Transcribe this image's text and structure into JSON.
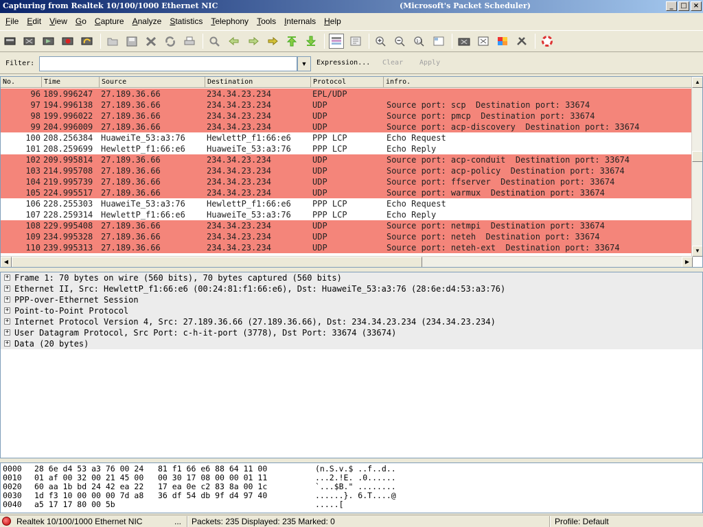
{
  "window": {
    "title_left": "Capturing from Realtek 10/100/1000 Ethernet NIC",
    "title_right": "(Microsoft's Packet Scheduler)"
  },
  "menu": [
    "File",
    "Edit",
    "View",
    "Go",
    "Capture",
    "Analyze",
    "Statistics",
    "Telephony",
    "Tools",
    "Internals",
    "Help"
  ],
  "filter": {
    "label": "Filter:",
    "value": "",
    "expression": "Expression...",
    "clear": "Clear",
    "apply": "Apply"
  },
  "packet_list": {
    "columns": [
      "No.",
      "Time",
      "Source",
      "Destination",
      "Protocol",
      "infro."
    ],
    "rows": [
      {
        "no": "96",
        "time": "189.996247",
        "src": "27.189.36.66",
        "dst": "234.34.23.234",
        "proto": "EPL/UDP",
        "info": "",
        "kind": "udp"
      },
      {
        "no": "97",
        "time": "194.996138",
        "src": "27.189.36.66",
        "dst": "234.34.23.234",
        "proto": "UDP",
        "info": "Source port: scp  Destination port: 33674",
        "kind": "udp"
      },
      {
        "no": "98",
        "time": "199.996022",
        "src": "27.189.36.66",
        "dst": "234.34.23.234",
        "proto": "UDP",
        "info": "Source port: pmcp  Destination port: 33674",
        "kind": "udp"
      },
      {
        "no": "99",
        "time": "204.996009",
        "src": "27.189.36.66",
        "dst": "234.34.23.234",
        "proto": "UDP",
        "info": "Source port: acp-discovery  Destination port: 33674",
        "kind": "udp"
      },
      {
        "no": "100",
        "time": "208.256384",
        "src": "HuaweiTe_53:a3:76",
        "dst": "HewlettP_f1:66:e6",
        "proto": "PPP LCP",
        "info": "Echo Request",
        "kind": "lcp"
      },
      {
        "no": "101",
        "time": "208.259699",
        "src": "HewlettP_f1:66:e6",
        "dst": "HuaweiTe_53:a3:76",
        "proto": "PPP LCP",
        "info": "Echo Reply",
        "kind": "lcp"
      },
      {
        "no": "102",
        "time": "209.995814",
        "src": "27.189.36.66",
        "dst": "234.34.23.234",
        "proto": "UDP",
        "info": "Source port: acp-conduit  Destination port: 33674",
        "kind": "udp"
      },
      {
        "no": "103",
        "time": "214.995708",
        "src": "27.189.36.66",
        "dst": "234.34.23.234",
        "proto": "UDP",
        "info": "Source port: acp-policy  Destination port: 33674",
        "kind": "udp"
      },
      {
        "no": "104",
        "time": "219.995739",
        "src": "27.189.36.66",
        "dst": "234.34.23.234",
        "proto": "UDP",
        "info": "Source port: ffserver  Destination port: 33674",
        "kind": "udp"
      },
      {
        "no": "105",
        "time": "224.995517",
        "src": "27.189.36.66",
        "dst": "234.34.23.234",
        "proto": "UDP",
        "info": "Source port: warmux  Destination port: 33674",
        "kind": "udp"
      },
      {
        "no": "106",
        "time": "228.255303",
        "src": "HuaweiTe_53:a3:76",
        "dst": "HewlettP_f1:66:e6",
        "proto": "PPP LCP",
        "info": "Echo Request",
        "kind": "lcp"
      },
      {
        "no": "107",
        "time": "228.259314",
        "src": "HewlettP_f1:66:e6",
        "dst": "HuaweiTe_53:a3:76",
        "proto": "PPP LCP",
        "info": "Echo Reply",
        "kind": "lcp"
      },
      {
        "no": "108",
        "time": "229.995408",
        "src": "27.189.36.66",
        "dst": "234.34.23.234",
        "proto": "UDP",
        "info": "Source port: netmpi  Destination port: 33674",
        "kind": "udp"
      },
      {
        "no": "109",
        "time": "234.995328",
        "src": "27.189.36.66",
        "dst": "234.34.23.234",
        "proto": "UDP",
        "info": "Source port: neteh  Destination port: 33674",
        "kind": "udp"
      },
      {
        "no": "110",
        "time": "239.995313",
        "src": "27.189.36.66",
        "dst": "234.34.23.234",
        "proto": "UDP",
        "info": "Source port: neteh-ext  Destination port: 33674",
        "kind": "udp"
      }
    ]
  },
  "details": [
    "Frame 1: 70 bytes on wire (560 bits), 70 bytes captured (560 bits)",
    "Ethernet II, Src: HewlettP_f1:66:e6 (00:24:81:f1:66:e6), Dst: HuaweiTe_53:a3:76 (28:6e:d4:53:a3:76)",
    "PPP-over-Ethernet Session",
    "Point-to-Point Protocol",
    "Internet Protocol Version 4, Src: 27.189.36.66 (27.189.36.66), Dst: 234.34.23.234 (234.34.23.234)",
    "User Datagram Protocol, Src Port: c-h-it-port (3778), Dst Port: 33674 (33674)",
    "Data (20 bytes)"
  ],
  "hex": [
    {
      "offset": "0000",
      "bytes": "28 6e d4 53 a3 76 00 24   81 f1 66 e6 88 64 11 00",
      "ascii": "(n.S.v.$ ..f..d.."
    },
    {
      "offset": "0010",
      "bytes": "01 af 00 32 00 21 45 00   00 30 17 08 00 00 01 11",
      "ascii": "...2.!E. .0......"
    },
    {
      "offset": "0020",
      "bytes": "60 aa 1b bd 24 42 ea 22   17 ea 0e c2 83 8a 00 1c",
      "ascii": "`...$B.\" ........"
    },
    {
      "offset": "0030",
      "bytes": "1d f3 10 00 00 00 7d a8   36 df 54 db 9f d4 97 40",
      "ascii": "......}. 6.T....@"
    },
    {
      "offset": "0040",
      "bytes": "a5 17 17 80 00 5b",
      "ascii": ".....["
    }
  ],
  "status": {
    "interface": "Realtek 10/100/1000 Ethernet NIC",
    "ellipsis": "...",
    "packets": "Packets: 235 Displayed: 235 Marked: 0",
    "profile": "Profile: Default"
  },
  "colors": {
    "udp_row": "#f4857a",
    "lcp_row": "#ffffff",
    "title_gradient_start": "#0a246a"
  },
  "toolbar_icons": [
    "interface-list-icon",
    "capture-options-icon",
    "start-capture-icon",
    "stop-capture-icon",
    "restart-capture-icon",
    "open-file-icon",
    "save-file-icon",
    "close-file-icon",
    "reload-icon",
    "print-icon",
    "find-icon",
    "go-back-icon",
    "go-forward-icon",
    "go-to-packet-icon",
    "go-first-icon",
    "go-last-icon",
    "colorize-icon",
    "autoscroll-icon",
    "zoom-in-icon",
    "zoom-out-icon",
    "normal-size-icon",
    "resize-columns-icon",
    "capture-filters-icon",
    "display-filters-icon",
    "coloring-rules-icon",
    "preferences-icon",
    "help-icon"
  ]
}
